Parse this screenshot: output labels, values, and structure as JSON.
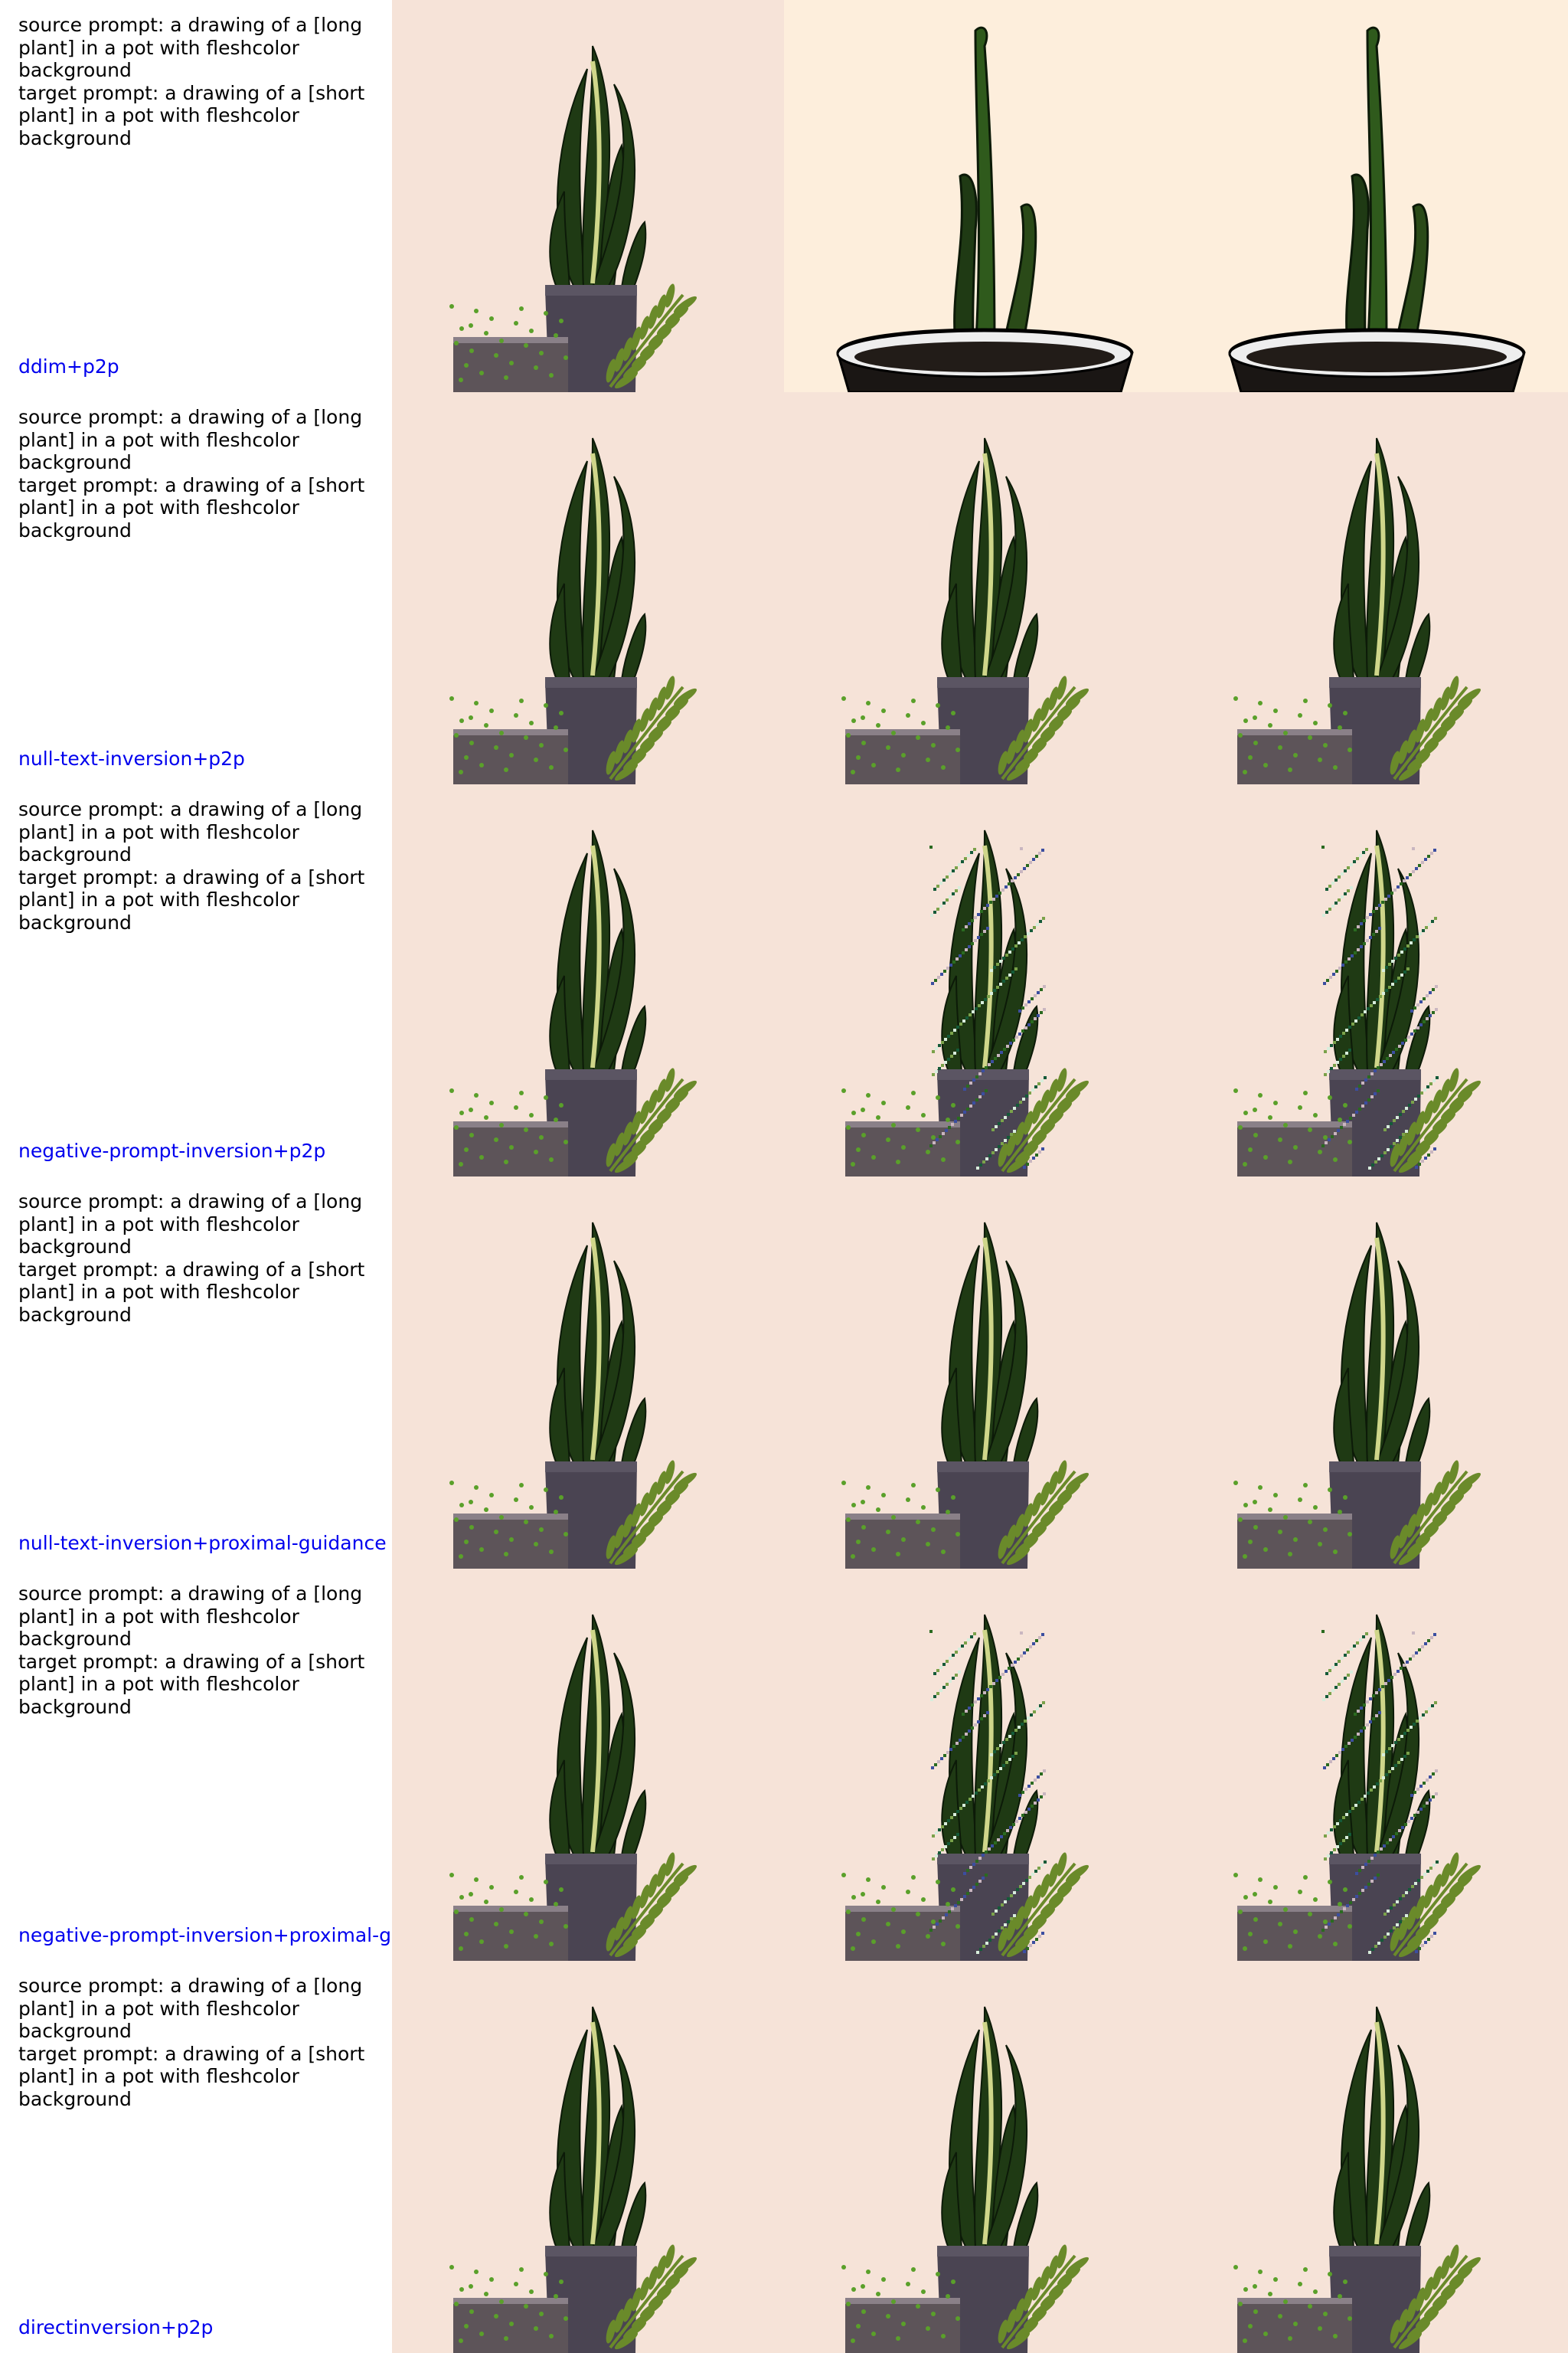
{
  "colors": {
    "method_label": "#0000ee",
    "flesh_bg": "#f6e3d8",
    "cream_bg": "#fdeedc",
    "leaf_dark": "#1f3a14",
    "leaf_light": "#cfd68a",
    "pot": "#4a4452",
    "fern": "#6a8a2a"
  },
  "rows": [
    {
      "prompt": "source prompt: a drawing of a [long\nplant] in a pot with fleshcolor\nbackground\ntarget prompt: a drawing of a [short\nplant] in a pot with fleshcolor\nbackground",
      "method": "ddim+p2p",
      "images": [
        "source-image",
        "edited-ddim-a",
        "edited-ddim-b"
      ]
    },
    {
      "prompt": "source prompt: a drawing of a [long\nplant] in a pot with fleshcolor\nbackground\ntarget prompt: a drawing of a [short\nplant] in a pot with fleshcolor\nbackground",
      "method": "null-text-inversion+p2p",
      "images": [
        "source-image",
        "edited-plant",
        "edited-plant"
      ]
    },
    {
      "prompt": "source prompt: a drawing of a [long\nplant] in a pot with fleshcolor\nbackground\ntarget prompt: a drawing of a [short\nplant] in a pot with fleshcolor\nbackground",
      "method": "negative-prompt-inversion+p2p",
      "images": [
        "source-image",
        "edited-noisy",
        "edited-noisy"
      ]
    },
    {
      "prompt": "source prompt: a drawing of a [long\nplant] in a pot with fleshcolor\nbackground\ntarget prompt: a drawing of a [short\nplant] in a pot with fleshcolor\nbackground",
      "method": "null-text-inversion+proximal-guidance",
      "images": [
        "source-image",
        "edited-plant",
        "edited-plant"
      ]
    },
    {
      "prompt": "source prompt: a drawing of a [long\nplant] in a pot with fleshcolor\nbackground\ntarget prompt: a drawing of a [short\nplant] in a pot with fleshcolor\nbackground",
      "method": "negative-prompt-inversion+proximal-g",
      "images": [
        "source-image",
        "edited-noisy",
        "edited-noisy"
      ]
    },
    {
      "prompt": "source prompt: a drawing of a [long\nplant] in a pot with fleshcolor\nbackground\ntarget prompt: a drawing of a [short\nplant] in a pot with fleshcolor\nbackground",
      "method": "directinversion+p2p",
      "images": [
        "source-image",
        "edited-plant",
        "edited-plant"
      ]
    }
  ]
}
